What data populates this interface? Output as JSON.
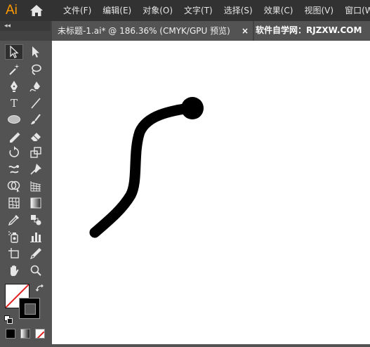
{
  "app": {
    "logo_text": "Ai",
    "brand_color": "#ff9a00"
  },
  "menu": {
    "items": [
      {
        "label": "文件(F)"
      },
      {
        "label": "编辑(E)"
      },
      {
        "label": "对象(O)"
      },
      {
        "label": "文字(T)"
      },
      {
        "label": "选择(S)"
      },
      {
        "label": "效果(C)"
      },
      {
        "label": "视图(V)"
      },
      {
        "label": "窗口(W)"
      }
    ]
  },
  "document_tab": {
    "title": "未标题-1.ai* @ 186.36% (CMYK/GPU 预览)",
    "close_label": "×"
  },
  "watermark": {
    "text": "软件自学网：RJZXW.COM"
  },
  "toolbar": {
    "collapse_glyph": "◂◂",
    "type_tool_glyph": "T",
    "selected_tool": "selection-tool-icon"
  },
  "colors": {
    "fill": "#ffffff",
    "stroke": "#000000",
    "none_indicator": "#e02020"
  }
}
